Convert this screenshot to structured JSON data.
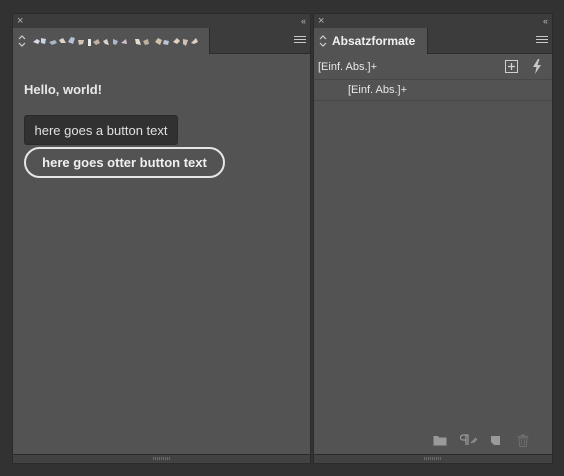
{
  "left_panel": {
    "tab_label": "",
    "hello_text": "Hello, world!",
    "button1_label": "here goes a button text",
    "button2_label": "here goes otter button text"
  },
  "right_panel": {
    "tab_label": "Absatzformate",
    "current_style": "[Einf. Abs.]+",
    "styles": [
      "[Einf. Abs.]+"
    ]
  },
  "chrome": {
    "close_glyph": "×",
    "collapse_glyph": "‹‹"
  },
  "icons": {
    "close": "close-icon",
    "collapse": "double-chevron-left-icon",
    "tab_updown": "up-down-arrows-icon",
    "panel_menu": "hamburger-menu-icon",
    "new_style_plus": "new-style-plus-icon",
    "clear_overrides": "lightning-icon",
    "folder": "folder-icon",
    "paragraph_style": "paragraph-style-icon",
    "new_item": "new-item-icon",
    "trash": "trash-icon"
  },
  "colors": {
    "panel_bg": "#535353",
    "chrome_bg": "#3c3c3c",
    "app_bg": "#323232",
    "text": "#e8e8e8"
  }
}
